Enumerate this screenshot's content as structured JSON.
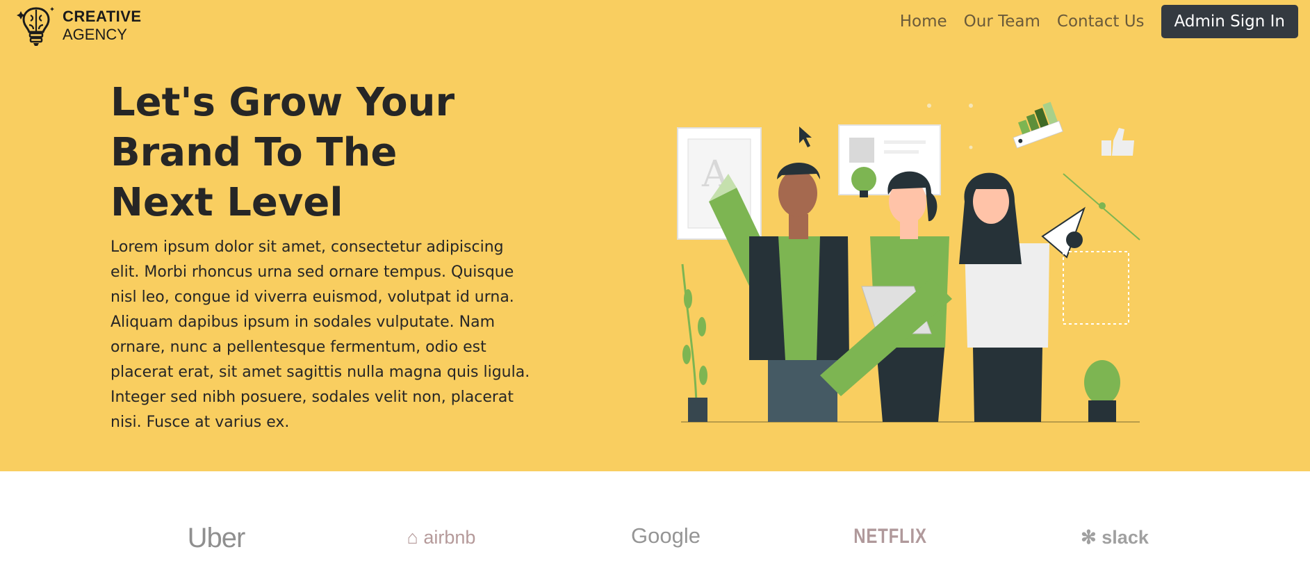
{
  "header": {
    "logo_line1": "CREATIVE",
    "logo_line2": "AGENCY",
    "nav": [
      {
        "label": "Home"
      },
      {
        "label": "Our Team"
      },
      {
        "label": "Contact Us"
      }
    ],
    "admin_button": "Admin Sign In"
  },
  "hero": {
    "headline": [
      "Let's Grow Your",
      "Brand To The",
      "Next Level"
    ],
    "paragraph": "Lorem ipsum dolor sit amet, consectetur adipiscing elit. Morbi rhoncus urna sed ornare tempus. Quisque nisl leo, congue id viverra euismod, volutpat id urna. Aliquam dapibus ipsum in sodales vulputate. Nam ornare, nunc a pellentesque fermentum, odio est placerat erat, sit amet sagittis nulla magna quis ligula. Integer sed nibh posuere, sodales velit non, placerat nisi. Fusce at varius ex.",
    "illustration_letter": "A"
  },
  "brands": [
    "Uber",
    "airbnb",
    "Google",
    "NETFLIX",
    "slack"
  ],
  "colors": {
    "hero_bg": "#f9ce60",
    "button_bg": "#343a40",
    "accent_green": "#7db552",
    "dark": "#263238"
  }
}
